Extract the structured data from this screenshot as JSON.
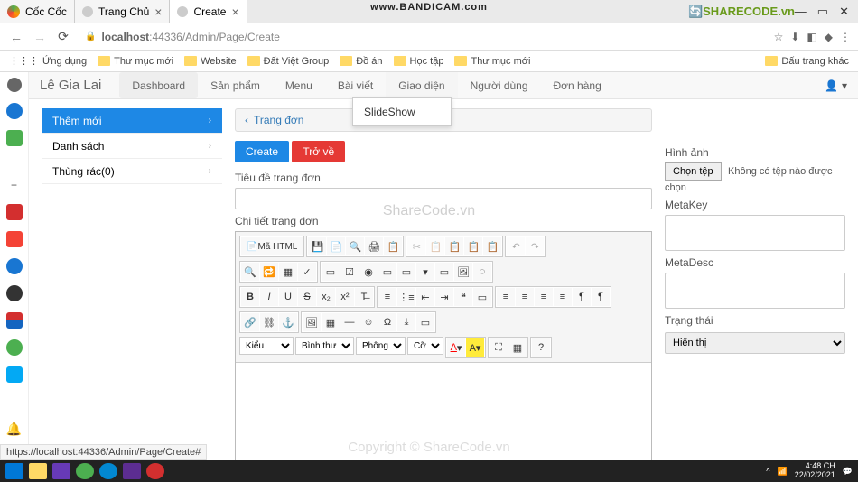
{
  "browser": {
    "tabs": [
      {
        "favicon": "#ff8c00",
        "label": "Cốc Cốc"
      },
      {
        "favicon": "#999",
        "label": "Trang Chủ"
      },
      {
        "favicon": "#999",
        "label": "Create"
      }
    ],
    "url_prefix": "localhost",
    "url": ":44336/Admin/Page/Create",
    "bookmarks_app": "Ứng dụng",
    "bookmarks": [
      "Thư mục mới",
      "Website",
      "Đất Việt Group",
      "Đồ án",
      "Học tập",
      "Thư mục mới"
    ],
    "bookmarks_other": "Dấu trang khác"
  },
  "brand": "Lê Gia Lai",
  "nav": {
    "items": [
      "Dashboard",
      "Sản phẩm",
      "Menu",
      "Bài viết",
      "Giao diện",
      "Người dùng",
      "Đơn hàng"
    ],
    "dropdown": "SlideShow"
  },
  "sidebar": {
    "items": [
      {
        "label": "Thêm mới",
        "active": true
      },
      {
        "label": "Danh sách",
        "active": false
      },
      {
        "label": "Thùng rác(0)",
        "active": false
      }
    ]
  },
  "breadcrumb": "Trang đơn",
  "buttons": {
    "create": "Create",
    "back": "Trở về"
  },
  "form": {
    "title_label": "Tiêu đề trang đơn",
    "detail_label": "Chi tiết trang đơn",
    "image_label": "Hình ảnh",
    "choose_file": "Chọn tệp",
    "no_file": "Không có tệp nào được chọn",
    "metakey": "MetaKey",
    "metadesc": "MetaDesc",
    "status_label": "Trạng thái",
    "status_value": "Hiển thị"
  },
  "editor": {
    "source": "Mã HTML",
    "style_sel": "Kiểu",
    "format_sel": "Bình thư...",
    "font_sel": "Phông",
    "size_sel": "Cỡ..."
  },
  "watermarks": {
    "bandi": "www.BANDICAM.com",
    "sharecode": "SHARECODE.vn",
    "center": "ShareCode.vn",
    "copyright": "Copyright © ShareCode.vn"
  },
  "status_url": "https://localhost:44336/Admin/Page/Create#",
  "taskbar": {
    "time": "4:48 CH",
    "date": "22/02/2021"
  }
}
